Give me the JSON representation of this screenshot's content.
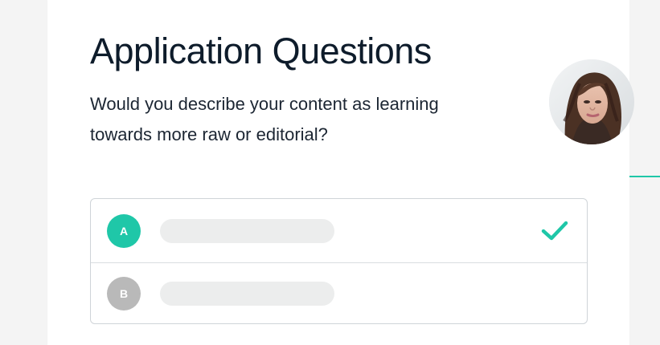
{
  "header": {
    "title": "Application Questions",
    "question": "Would you describe your content as learning towards more raw or editorial?"
  },
  "avatar": {
    "icon": "user-avatar-photo"
  },
  "options": [
    {
      "letter": "A",
      "selected": true,
      "color": "#1fc7a8"
    },
    {
      "letter": "B",
      "selected": false,
      "color": "#b9b9b9"
    }
  ],
  "colors": {
    "accent": "#1fc7a8",
    "title": "#0e1c2b",
    "text": "#1c2633",
    "placeholder": "#eceded",
    "border": "#cfd4d8"
  },
  "icons": {
    "selected": "check-icon"
  }
}
